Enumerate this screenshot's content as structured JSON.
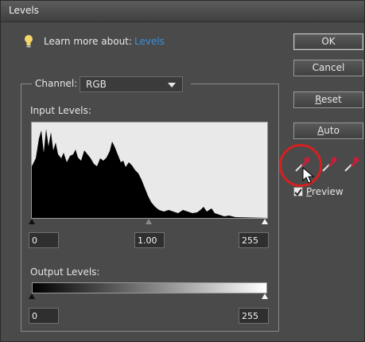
{
  "window": {
    "title": "Levels"
  },
  "learn_more": {
    "label": "Learn more about:",
    "link": "Levels"
  },
  "channel": {
    "label": "Channel:",
    "selected": "RGB"
  },
  "input_levels": {
    "label": "Input Levels:",
    "black_point": "0",
    "midtone": "1.00",
    "white_point": "255"
  },
  "output_levels": {
    "label": "Output Levels:",
    "black_point": "0",
    "white_point": "255"
  },
  "buttons": {
    "ok": "OK",
    "cancel": "Cancel",
    "reset_underlined": "R",
    "reset_rest": "eset",
    "auto_underlined": "A",
    "auto_rest": "uto"
  },
  "preview": {
    "label_underlined": "P",
    "label_rest": "review",
    "checked": true
  },
  "icons": {
    "lightbulb": "lightbulb-icon",
    "black_eyedropper": "black-eyedropper-icon",
    "gray_eyedropper": "gray-eyedropper-icon",
    "white_eyedropper": "white-eyedropper-icon",
    "cursor": "arrow-cursor-icon"
  },
  "colors": {
    "accent_link": "#3a8fd8",
    "highlight_ring": "#d62020",
    "eyedropper": "#c4203a"
  }
}
